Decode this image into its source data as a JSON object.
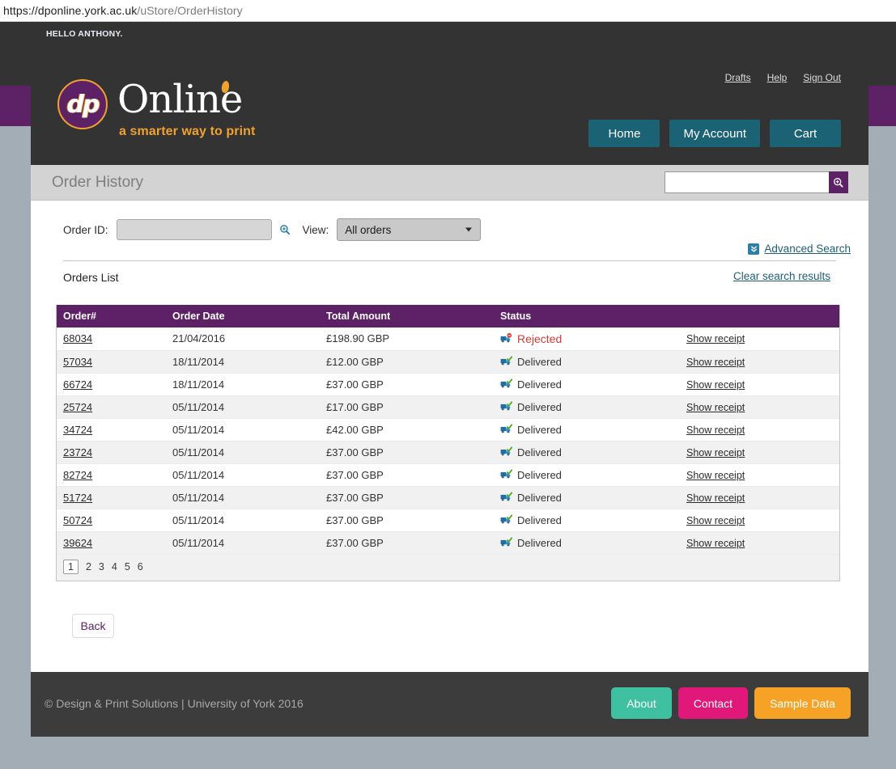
{
  "browser": {
    "url_domain": "https://dponline.york.ac.uk",
    "url_path": "/uStore/OrderHistory"
  },
  "greeting": "HELLO ANTHONY.",
  "brand": {
    "mark_text": "dp",
    "word": "Online",
    "tagline": "a smarter way to print",
    "colors": {
      "purple": "#5d2266",
      "orange": "#f0a12e",
      "teal": "#1b6275",
      "dark": "#333333"
    }
  },
  "header": {
    "links": [
      {
        "label": "Drafts"
      },
      {
        "label": "Help"
      },
      {
        "label": "Sign Out"
      }
    ],
    "buttons": [
      {
        "label": "Home"
      },
      {
        "label": "My Account"
      },
      {
        "label": "Cart"
      }
    ]
  },
  "title_bar": {
    "title": "Order History",
    "search_value": "",
    "search_placeholder": "",
    "search_icon": "magnifier-plus-icon"
  },
  "filters": {
    "order_id_label": "Order ID:",
    "order_id_value": "",
    "order_id_placeholder": "",
    "lookup_icon": "magnifier-plus-icon",
    "view_label": "View:",
    "view_selected": "All orders",
    "view_options": [
      "All orders"
    ],
    "advanced_search_label": "Advanced Search",
    "advanced_search_icon": "double-chevron-down-icon"
  },
  "list": {
    "heading": "Orders List",
    "clear_label": "Clear search results",
    "columns": [
      "Order#",
      "Order Date",
      "Total Amount",
      "Status",
      ""
    ],
    "action_label": "Show receipt",
    "rows": [
      {
        "order": "68034",
        "date": "21/04/2016",
        "amount": "£198.90 GBP",
        "status": "Rejected",
        "status_icon": "truck-rejected-icon",
        "action": "Show receipt"
      },
      {
        "order": "57034",
        "date": "18/11/2014",
        "amount": "£12.00 GBP",
        "status": "Delivered",
        "status_icon": "truck-delivered-icon",
        "action": "Show receipt"
      },
      {
        "order": "66724",
        "date": "18/11/2014",
        "amount": "£37.00 GBP",
        "status": "Delivered",
        "status_icon": "truck-delivered-icon",
        "action": "Show receipt"
      },
      {
        "order": "25724",
        "date": "05/11/2014",
        "amount": "£17.00 GBP",
        "status": "Delivered",
        "status_icon": "truck-delivered-icon",
        "action": "Show receipt"
      },
      {
        "order": "34724",
        "date": "05/11/2014",
        "amount": "£42.00 GBP",
        "status": "Delivered",
        "status_icon": "truck-delivered-icon",
        "action": "Show receipt"
      },
      {
        "order": "23724",
        "date": "05/11/2014",
        "amount": "£37.00 GBP",
        "status": "Delivered",
        "status_icon": "truck-delivered-icon",
        "action": "Show receipt"
      },
      {
        "order": "82724",
        "date": "05/11/2014",
        "amount": "£37.00 GBP",
        "status": "Delivered",
        "status_icon": "truck-delivered-icon",
        "action": "Show receipt"
      },
      {
        "order": "51724",
        "date": "05/11/2014",
        "amount": "£37.00 GBP",
        "status": "Delivered",
        "status_icon": "truck-delivered-icon",
        "action": "Show receipt"
      },
      {
        "order": "50724",
        "date": "05/11/2014",
        "amount": "£37.00 GBP",
        "status": "Delivered",
        "status_icon": "truck-delivered-icon",
        "action": "Show receipt"
      },
      {
        "order": "39624",
        "date": "05/11/2014",
        "amount": "£37.00 GBP",
        "status": "Delivered",
        "status_icon": "truck-delivered-icon",
        "action": "Show receipt"
      }
    ],
    "pagination": {
      "pages": [
        "1",
        "2",
        "3",
        "4",
        "5",
        "6"
      ],
      "current": "1"
    }
  },
  "back_button": {
    "label": "Back"
  },
  "footer": {
    "copyright": "© Design & Print Solutions | University of York 2016",
    "buttons": [
      {
        "label": "About",
        "color": "#3fc0a0"
      },
      {
        "label": "Contact",
        "color": "#e0187a"
      },
      {
        "label": "Sample Data",
        "color": "#f5a227"
      }
    ]
  }
}
